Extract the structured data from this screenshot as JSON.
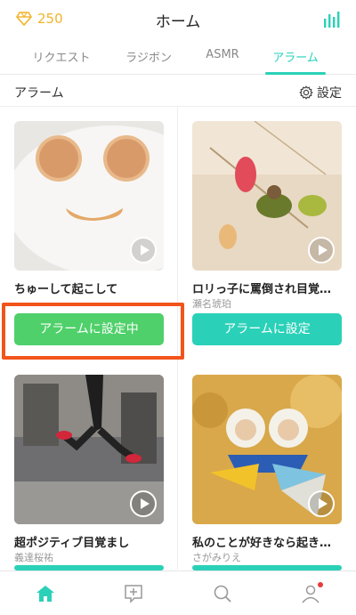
{
  "header": {
    "gem_count": "250",
    "title": "ホーム"
  },
  "tabs": [
    {
      "label": "リクエスト",
      "active": false
    },
    {
      "label": "ラジボン",
      "active": false
    },
    {
      "label": "ASMR",
      "active": false
    },
    {
      "label": "アラーム",
      "active": true
    }
  ],
  "section": {
    "title": "アラーム",
    "settings_label": "設定"
  },
  "cards": [
    {
      "title": "ちゅーして起こして",
      "artist": "",
      "button_label": "アラームに設定中",
      "state": "set"
    },
    {
      "title": "ロリっ子に罵倒され目覚…",
      "artist": "瀬名琥珀",
      "button_label": "アラームに設定",
      "state": "unset"
    },
    {
      "title": "超ポジティブ目覚まし",
      "artist": "義達桜祐",
      "button_label": "",
      "state": "unset"
    },
    {
      "title": "私のことが好きなら起き…",
      "artist": "さがみりえ",
      "button_label": "",
      "state": "unset"
    }
  ],
  "bottom_nav": [
    {
      "icon": "home-icon",
      "active": true
    },
    {
      "icon": "post-icon",
      "active": false
    },
    {
      "icon": "search-icon",
      "active": false
    },
    {
      "icon": "profile-icon",
      "active": false,
      "badge": true
    }
  ],
  "colors": {
    "accent": "#2ad1b8",
    "set_green": "#4fd06a",
    "gem_gold": "#f2b42b",
    "highlight": "#f2541b"
  }
}
